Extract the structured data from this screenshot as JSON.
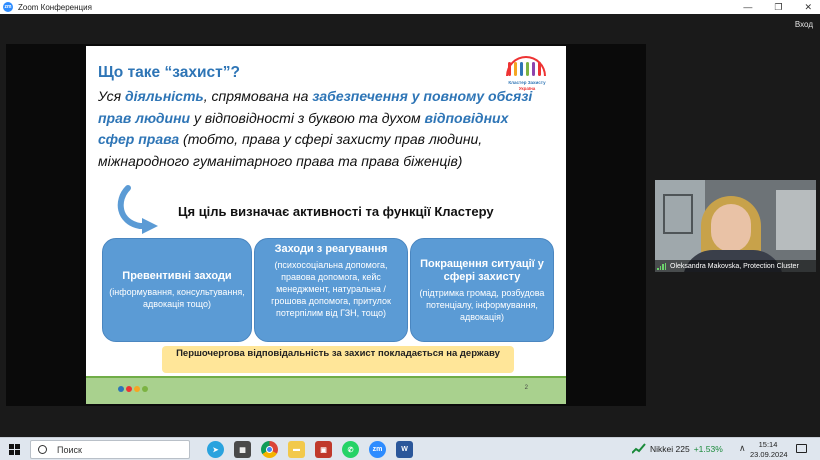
{
  "window": {
    "title": "Zoom Конференция",
    "app_icon_text": "zm",
    "controls": {
      "minimize": "—",
      "maximize": "❐",
      "close": "✕"
    },
    "exit_label": "Вход"
  },
  "slide": {
    "heading": "Що таке “захист”?",
    "logo_line1": "Кластер Захисту",
    "logo_line2": "Україна",
    "body": {
      "t1": "Уся ",
      "h1": "діяльність",
      "t2": ", спрямована на ",
      "h2": "забезпечення у повному обсязі прав людини",
      "t3": " у відповідності з буквою та духом ",
      "h3": "відповідних сфер права",
      "t4": " (тобто, права у сфері захисту прав людини, міжнародного гуманітарного права та права біженців)"
    },
    "subheading": "Ця ціль визначає активності та функції Кластеру",
    "boxes": [
      {
        "title": "Превентивні заходи",
        "detail": "(інформування, консультування, адвокація тощо)"
      },
      {
        "title": "Заходи з реагування",
        "detail": "(психосоціальна допомога, правова допомога, кейс менеджмент, натуральна / грошова допомога, притулок потерпілим від ГЗН, тощо)"
      },
      {
        "title": "Покращення ситуації у сфері захисту",
        "detail": "(підтримка громад, розбудова потенціалу, інформування, адвокація)"
      }
    ],
    "banner": "Першочергова відповідальність за захист покладається на державу",
    "page_number": "2",
    "colors": {
      "accent_blue": "#2e75b6",
      "box_blue": "#5b9bd5",
      "banner_yellow": "#ffe699",
      "footer_green": "#a9d18e"
    }
  },
  "participant": {
    "name": "Oleksandra Makovska, Protection Cluster"
  },
  "taskbar": {
    "search_placeholder": "Поиск",
    "apps": [
      "telegram-icon",
      "calculator-icon",
      "chrome-icon",
      "file-explorer-icon",
      "photos-icon",
      "whatsapp-icon",
      "zoom-icon",
      "word-icon"
    ],
    "zoom_app_label": "zm",
    "word_app_label": "W",
    "ticker_name": "Nikkei 225",
    "ticker_change": "+1.53%",
    "tray_arrow": "∧",
    "time": "15:14",
    "date": "23.09.2024"
  }
}
